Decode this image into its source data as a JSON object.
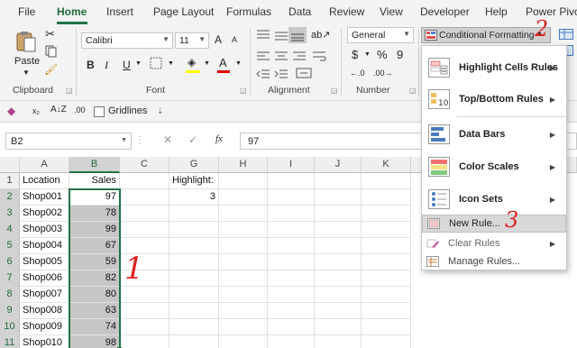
{
  "menu": {
    "tabs": [
      "File",
      "Home",
      "Insert",
      "Page Layout",
      "Formulas",
      "Data",
      "Review",
      "View",
      "Developer",
      "Help",
      "Power Pivot"
    ],
    "active": "Home"
  },
  "ribbon": {
    "clipboard": {
      "label": "Clipboard",
      "paste_label": "Paste"
    },
    "font": {
      "label": "Font",
      "name": "Calibri",
      "size": "11",
      "bold": "B",
      "italic": "I",
      "underline": "U",
      "grow": "A",
      "shrink": "A",
      "font_color_letter": "A"
    },
    "alignment": {
      "label": "Alignment"
    },
    "number": {
      "label": "Number",
      "format": "General",
      "currency": "$",
      "percent": "%",
      "comma": "9"
    },
    "conditional_formatting": {
      "label": "Conditional Formatting"
    }
  },
  "quick_toolbar": {
    "gridlines_label": "Gridlines",
    "gridlines_checked": false
  },
  "formula_bar": {
    "name_box": "B2",
    "value": "97",
    "fx": "fx"
  },
  "sheet": {
    "columns": [
      "A",
      "B",
      "C",
      "G",
      "H",
      "I",
      "J",
      "K"
    ],
    "rows": [
      "1",
      "2",
      "3",
      "4",
      "5",
      "6",
      "7",
      "8",
      "9",
      "10",
      "11"
    ],
    "header_row": {
      "A": "Location",
      "B": "Sales",
      "G": "Highlight:"
    },
    "highlight_value": "3",
    "data": [
      {
        "location": "Shop001",
        "sales": "97"
      },
      {
        "location": "Shop002",
        "sales": "78"
      },
      {
        "location": "Shop003",
        "sales": "99"
      },
      {
        "location": "Shop004",
        "sales": "67"
      },
      {
        "location": "Shop005",
        "sales": "59"
      },
      {
        "location": "Shop006",
        "sales": "82"
      },
      {
        "location": "Shop007",
        "sales": "80"
      },
      {
        "location": "Shop008",
        "sales": "63"
      },
      {
        "location": "Shop009",
        "sales": "74"
      },
      {
        "location": "Shop010",
        "sales": "98"
      }
    ]
  },
  "dropdown": {
    "items": [
      {
        "label": "Highlight Cells Rules",
        "icon": "highlight-cells-icon"
      },
      {
        "label": "Top/Bottom Rules",
        "icon": "top-bottom-icon"
      },
      {
        "label": "Data Bars",
        "icon": "data-bars-icon"
      },
      {
        "label": "Color Scales",
        "icon": "color-scales-icon"
      },
      {
        "label": "Icon Sets",
        "icon": "icon-sets-icon"
      }
    ],
    "small_items": [
      {
        "label": "New Rule...",
        "icon": "new-rule-icon"
      },
      {
        "label": "Clear Rules",
        "icon": "clear-rules-icon"
      },
      {
        "label": "Manage Rules...",
        "icon": "manage-rules-icon"
      }
    ]
  },
  "annotations": [
    "1",
    "2",
    "3"
  ],
  "colors": {
    "accent": "#217346",
    "annotation": "#e02020",
    "selection": "#c6c6c6"
  }
}
